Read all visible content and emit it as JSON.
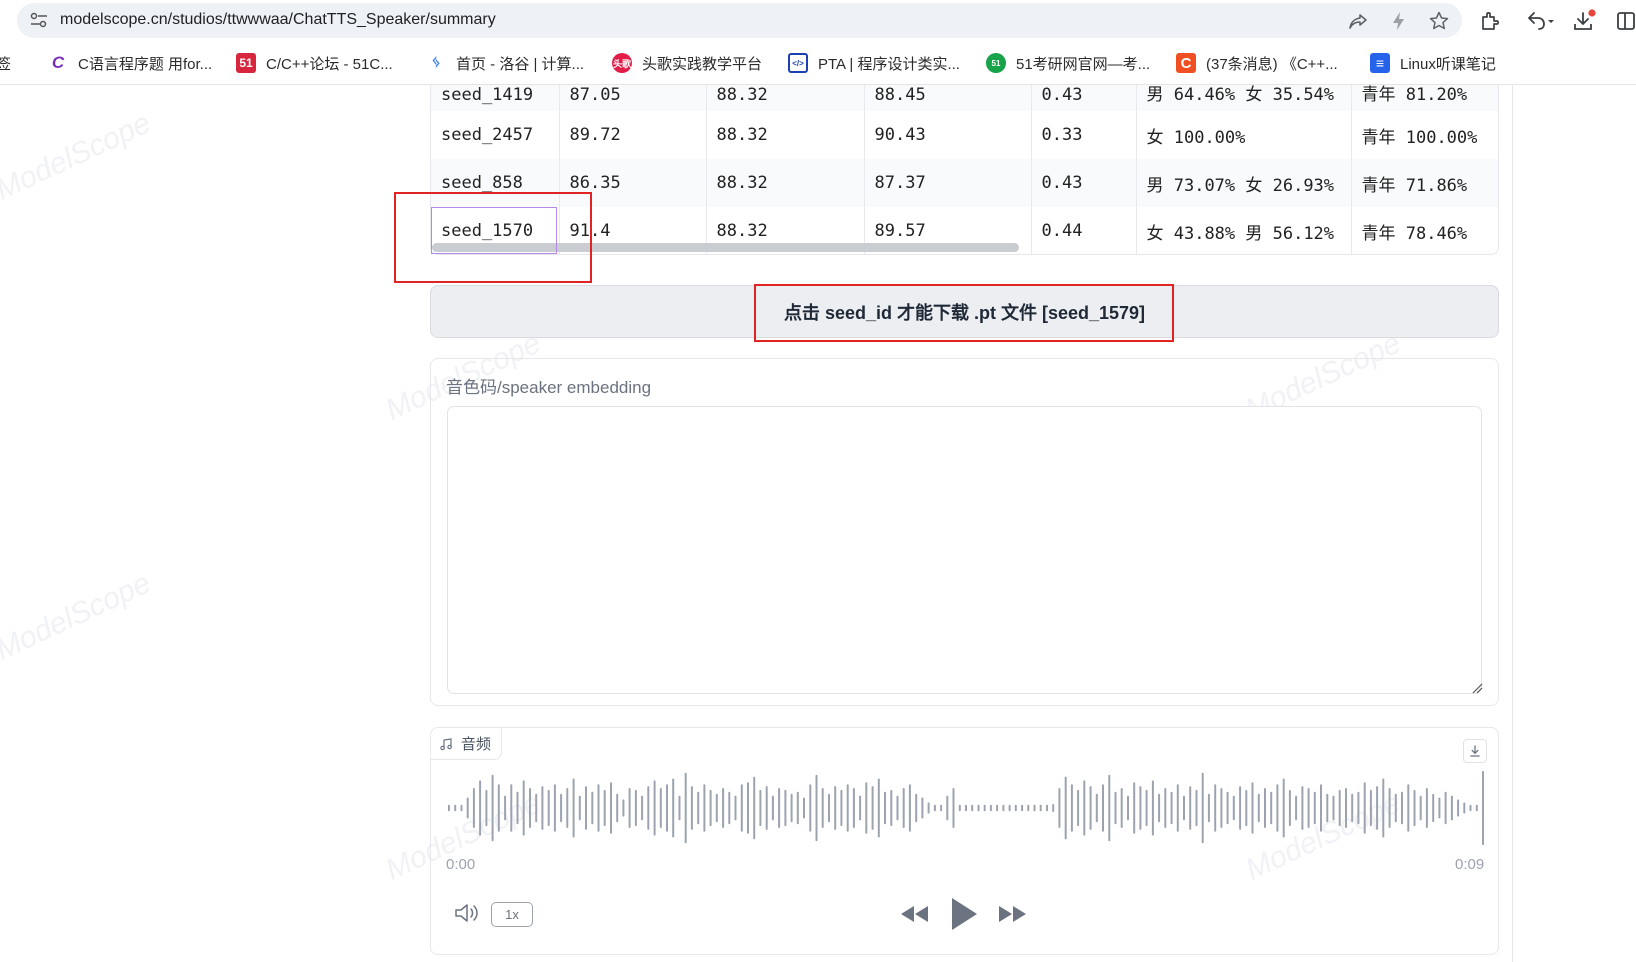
{
  "browser": {
    "url": "modelscope.cn/studios/ttwwwaa/ChatTTS_Speaker/summary",
    "bookmarks": [
      {
        "label": "签",
        "icon_text": "",
        "color": "#ffffff"
      },
      {
        "label": "C语言程序题 用for...",
        "icon_text": "C",
        "color": "#7b2fbe"
      },
      {
        "label": "C/C++论坛 - 51C...",
        "icon_text": "51",
        "color": "#d7263d"
      },
      {
        "label": "首页 - 洛谷 | 计算...",
        "icon_text": "ᛃ",
        "color": "#3b82f6"
      },
      {
        "label": "头歌实践教学平台",
        "icon_text": "头歌",
        "color": "#e11d48"
      },
      {
        "label": "PTA | 程序设计类实...",
        "icon_text": "</>",
        "color": "#1e40af"
      },
      {
        "label": "51考研网官网—考...",
        "icon_text": "51",
        "color": "#16a34a"
      },
      {
        "label": "(37条消息) 《C++...",
        "icon_text": "C",
        "color": "#f04e23"
      },
      {
        "label": "Linux听课笔记",
        "icon_text": "≡",
        "color": "#2563eb"
      }
    ]
  },
  "table": {
    "rows": [
      [
        "seed_1419",
        "87.05",
        "88.32",
        "88.45",
        "0.43",
        "男 64.46% 女 35.54%",
        "青年 81.20%"
      ],
      [
        "seed_2457",
        "89.72",
        "88.32",
        "90.43",
        "0.33",
        "女 100.00%",
        "青年 100.00%"
      ],
      [
        "seed_858",
        "86.35",
        "88.32",
        "87.37",
        "0.43",
        "男 73.07% 女 26.93%",
        "青年 71.86%"
      ],
      [
        "seed_1570",
        "91.4",
        "88.32",
        "89.57",
        "0.44",
        "女 43.88% 男 56.12%",
        "青年 78.46%"
      ]
    ]
  },
  "download": {
    "label": "点击 seed_id 才能下载 .pt 文件 [seed_1579]"
  },
  "embedding": {
    "label": "音色码/speaker embedding",
    "value": ""
  },
  "audio": {
    "label": "音频",
    "time_start": "0:00",
    "time_end": "0:09",
    "rate": "1x",
    "waveform_levels": [
      0.06,
      0.06,
      0.06,
      0.25,
      0.5,
      0.7,
      0.45,
      0.85,
      0.6,
      0.3,
      0.6,
      0.4,
      0.7,
      0.5,
      0.35,
      0.55,
      0.45,
      0.6,
      0.35,
      0.5,
      0.75,
      0.3,
      0.55,
      0.4,
      0.6,
      0.45,
      0.65,
      0.35,
      0.2,
      0.5,
      0.45,
      0.3,
      0.55,
      0.7,
      0.5,
      0.6,
      0.75,
      0.3,
      0.9,
      0.55,
      0.4,
      0.6,
      0.45,
      0.35,
      0.5,
      0.4,
      0.3,
      0.6,
      0.65,
      0.8,
      0.45,
      0.55,
      0.3,
      0.5,
      0.45,
      0.35,
      0.4,
      0.25,
      0.6,
      0.85,
      0.5,
      0.35,
      0.55,
      0.45,
      0.6,
      0.5,
      0.3,
      0.65,
      0.55,
      0.75,
      0.4,
      0.45,
      0.3,
      0.5,
      0.6,
      0.35,
      0.25,
      0.12,
      0.06,
      0.06,
      0.3,
      0.5,
      0.06,
      0.06,
      0.06,
      0.06,
      0.06,
      0.06,
      0.06,
      0.06,
      0.06,
      0.06,
      0.06,
      0.06,
      0.06,
      0.06,
      0.06,
      0.08,
      0.5,
      0.8,
      0.6,
      0.45,
      0.7,
      0.55,
      0.35,
      0.6,
      0.85,
      0.4,
      0.5,
      0.3,
      0.65,
      0.55,
      0.45,
      0.7,
      0.35,
      0.5,
      0.4,
      0.6,
      0.3,
      0.55,
      0.45,
      0.9,
      0.35,
      0.6,
      0.5,
      0.4,
      0.3,
      0.55,
      0.45,
      0.65,
      0.35,
      0.5,
      0.4,
      0.6,
      0.75,
      0.45,
      0.3,
      0.55,
      0.5,
      0.4,
      0.6,
      0.35,
      0.3,
      0.45,
      0.5,
      0.35,
      0.4,
      0.65,
      0.45,
      0.55,
      0.75,
      0.5,
      0.35,
      0.4,
      0.6,
      0.45,
      0.3,
      0.5,
      0.35,
      0.25,
      0.4,
      0.3,
      0.2,
      0.12,
      0.06,
      0.06,
      0.95
    ]
  }
}
